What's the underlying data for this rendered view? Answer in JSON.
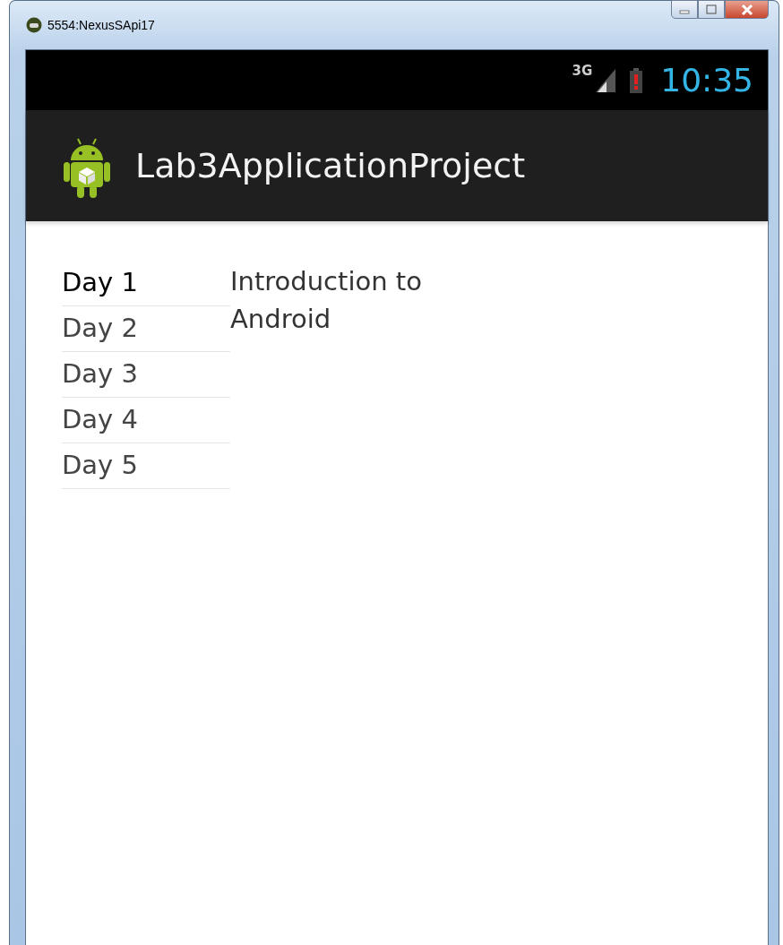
{
  "window": {
    "title": "5554:NexusSApi17"
  },
  "status_bar": {
    "network": "3G",
    "time": "10:35"
  },
  "action_bar": {
    "title": "Lab3ApplicationProject"
  },
  "days": [
    {
      "label": "Day 1",
      "selected": true
    },
    {
      "label": "Day 2",
      "selected": false
    },
    {
      "label": "Day 3",
      "selected": false
    },
    {
      "label": "Day 4",
      "selected": false
    },
    {
      "label": "Day 5",
      "selected": false
    }
  ],
  "detail": {
    "text": "Introduction to Android"
  }
}
